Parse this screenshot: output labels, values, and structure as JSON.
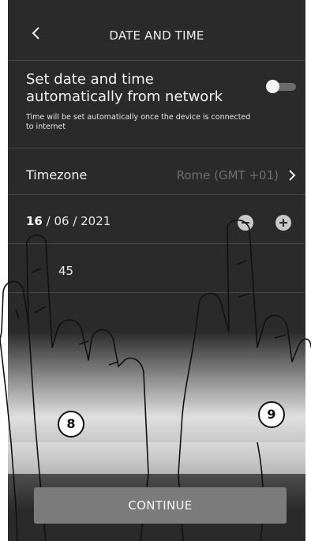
{
  "header": {
    "title": "DATE AND TIME",
    "back_icon": "chevron-left-icon"
  },
  "auto_sync": {
    "title": "Set date and time automatically from network",
    "note": "Time will be set automatically once the device is connected to internet",
    "enabled": false
  },
  "timezone": {
    "label": "Timezone",
    "value": "Rome (GMT +01)"
  },
  "date": {
    "day": "16",
    "rest": " / 06 / 2021"
  },
  "time": {
    "minutes": "45"
  },
  "continue_label": "CONTINUE",
  "callouts": {
    "left": "8",
    "right": "9"
  },
  "colors": {
    "background": "#2a2a2a",
    "button": "#7b7b7b",
    "muted_text": "#6f6f6f"
  }
}
